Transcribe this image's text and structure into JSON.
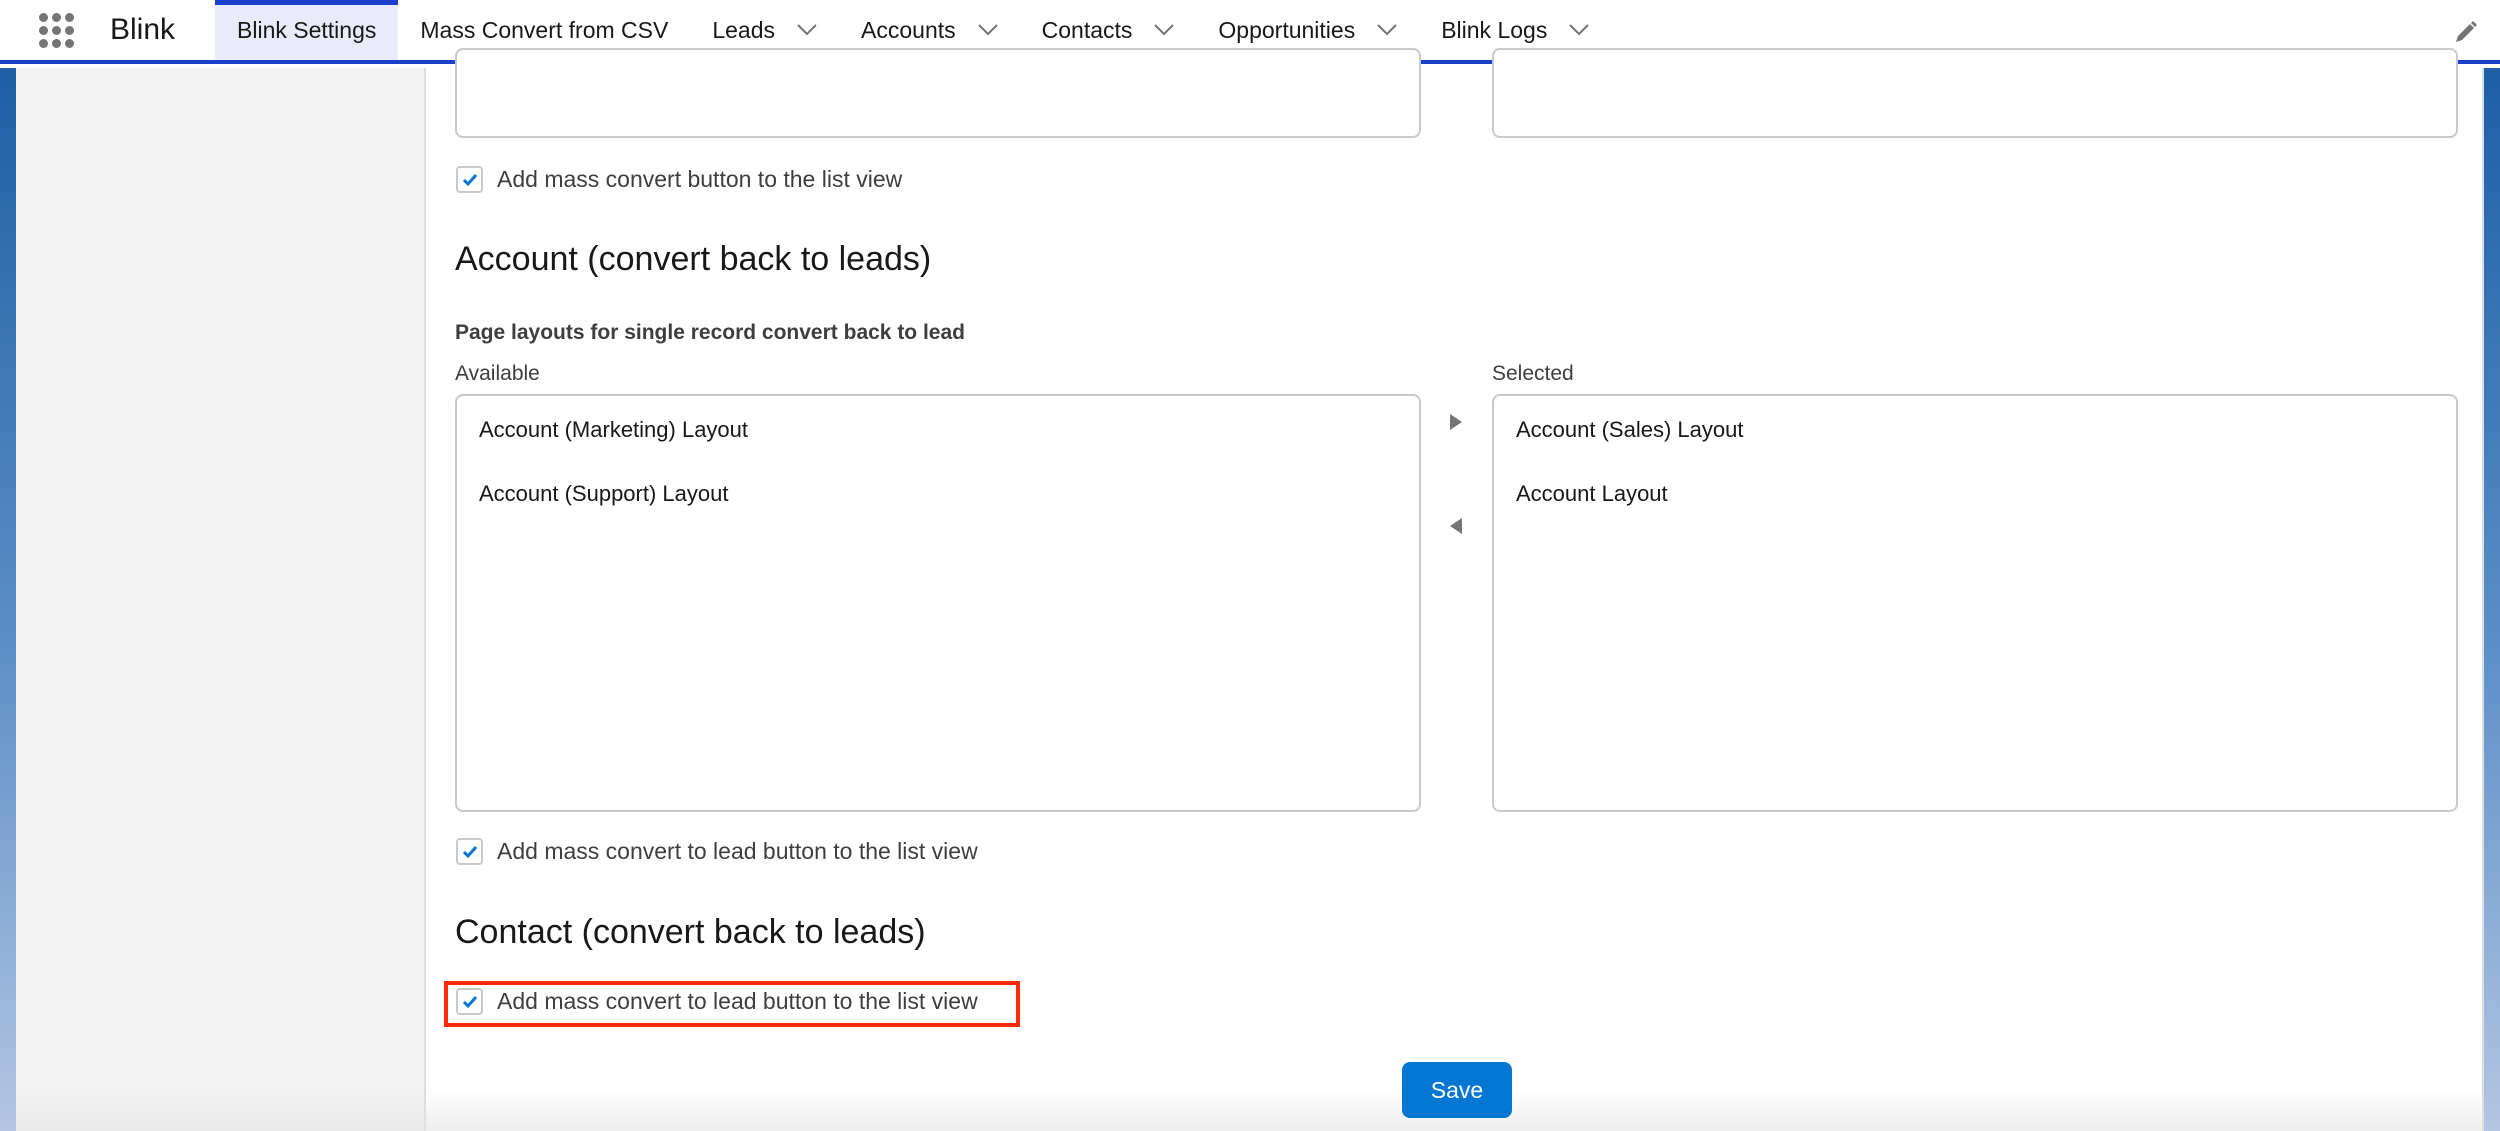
{
  "app": {
    "name": "Blink",
    "launcher_icon": "app-launcher-grid-icon",
    "edit_icon": "pencil-icon"
  },
  "nav": {
    "tabs": [
      {
        "label": "Blink Settings",
        "active": true,
        "has_menu": false
      },
      {
        "label": "Mass Convert from CSV",
        "active": false,
        "has_menu": false
      },
      {
        "label": "Leads",
        "active": false,
        "has_menu": true
      },
      {
        "label": "Accounts",
        "active": false,
        "has_menu": true
      },
      {
        "label": "Contacts",
        "active": false,
        "has_menu": true
      },
      {
        "label": "Opportunities",
        "active": false,
        "has_menu": true
      },
      {
        "label": "Blink Logs",
        "active": false,
        "has_menu": true
      }
    ]
  },
  "colors": {
    "accent": "#1b3fcb",
    "active_tab_bg": "#e9ebf8",
    "primary_button": "#0176d3",
    "checkbox_check": "#0176d3",
    "highlight_box": "#ff2a0a"
  },
  "lead_section": {
    "mass_convert_checkbox": {
      "label": "Add mass convert button to the list view",
      "checked": true
    }
  },
  "account_section": {
    "title": "Account (convert back to leads)",
    "subtitle": "Page layouts for single record convert back to lead",
    "available_label": "Available",
    "selected_label": "Selected",
    "available": [
      "Account (Marketing) Layout",
      "Account (Support) Layout"
    ],
    "selected": [
      "Account (Sales) Layout",
      "Account Layout"
    ],
    "move_right_icon": "triangle-right-icon",
    "move_left_icon": "triangle-left-icon",
    "mass_convert_checkbox": {
      "label": "Add mass convert to lead button to the list view",
      "checked": true
    }
  },
  "contact_section": {
    "title": "Contact (convert back to leads)",
    "mass_convert_checkbox": {
      "label": "Add mass convert to lead button to the list view",
      "checked": true,
      "highlighted": true
    }
  },
  "actions": {
    "save_label": "Save"
  }
}
